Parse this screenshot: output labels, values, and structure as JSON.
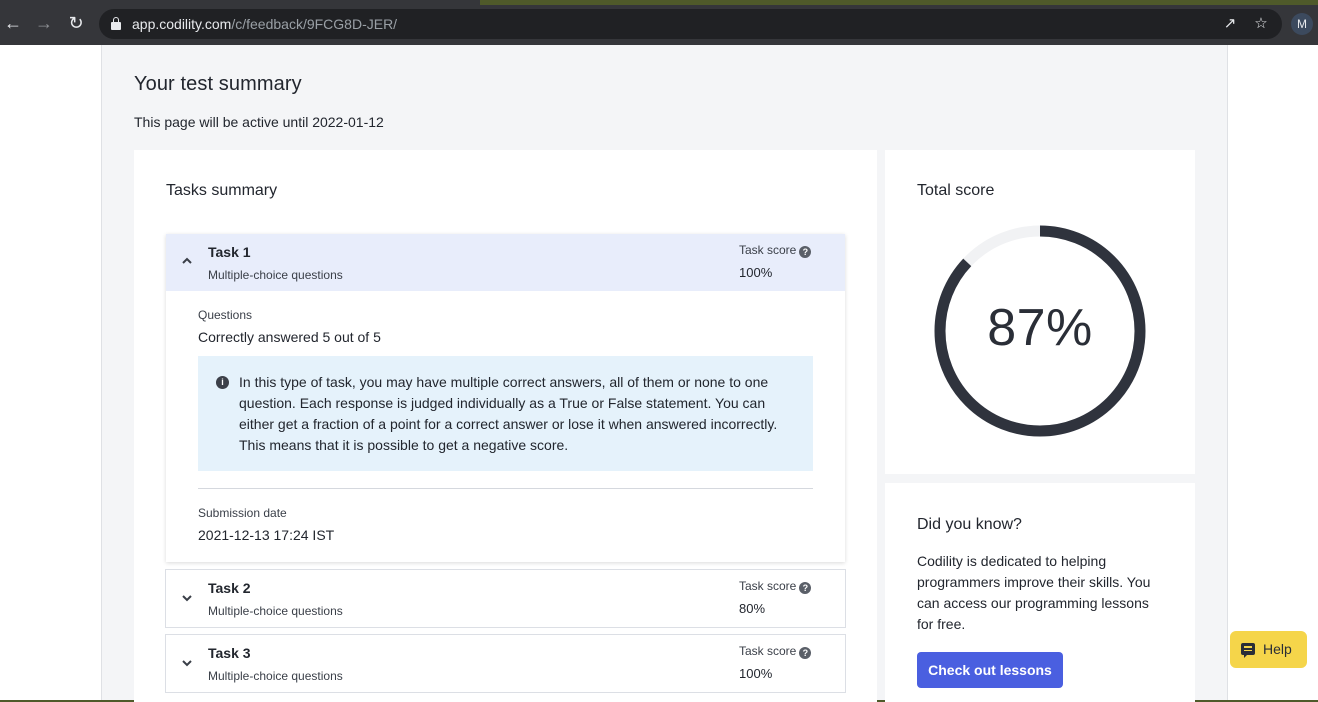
{
  "browser": {
    "url_host": "app.codility.com",
    "url_path": "/c/feedback/9FCG8D-JER/",
    "avatar_initial": "M",
    "icons": [
      "back-arrow-icon",
      "forward-arrow-icon",
      "reload-icon",
      "lock-icon",
      "share-icon",
      "star-icon"
    ]
  },
  "page": {
    "title": "Your test summary",
    "active_until": "This page will be active until 2022-01-12"
  },
  "tasks_summary": {
    "title": "Tasks summary",
    "score_label": "Task score",
    "tasks": [
      {
        "name": "Task 1",
        "type": "Multiple-choice questions",
        "score": "100%",
        "expanded": true,
        "questions_label": "Questions",
        "questions_value": "Correctly answered 5 out of 5",
        "info": "In this type of task, you may have multiple correct answers, all of them or none to one question. Each response is judged individually as a True or False statement. You can either get a fraction of a point for a correct answer or lose it when answered incorrectly. This means that it is possible to get a negative score.",
        "submission_label": "Submission date",
        "submission_value": "2021-12-13 17:24 IST"
      },
      {
        "name": "Task 2",
        "type": "Multiple-choice questions",
        "score": "80%",
        "expanded": false
      },
      {
        "name": "Task 3",
        "type": "Multiple-choice questions",
        "score": "100%",
        "expanded": false
      }
    ]
  },
  "total_score": {
    "title": "Total score",
    "value": "87%",
    "fraction": 0.87,
    "ring_color": "#2f333d",
    "track_color": "#f1f2f4"
  },
  "did_you_know": {
    "title": "Did you know?",
    "text": "Codility is dedicated to helping programmers improve their skills. You can access our programming lessons for free.",
    "button": "Check out lessons"
  },
  "help": {
    "label": "Help"
  },
  "colors": {
    "accent": "#4a5fe0",
    "task_header_bg": "#e8edfb",
    "info_bg": "#e5f2fb",
    "help_bg": "#f5d54a"
  }
}
